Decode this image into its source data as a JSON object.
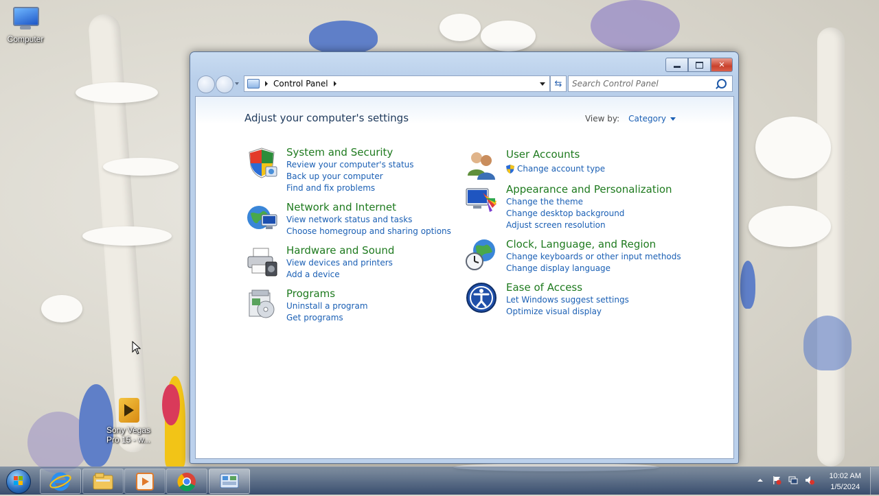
{
  "desktop": {
    "icons": [
      {
        "label": "Computer"
      },
      {
        "label": "Sony Vegas Pro 15 - w..."
      }
    ]
  },
  "window": {
    "breadcrumb": [
      "Control Panel"
    ],
    "search": {
      "placeholder": "Search Control Panel"
    },
    "page_title": "Adjust your computer's settings",
    "view_by": {
      "label": "View by:",
      "value": "Category"
    },
    "categories": [
      {
        "title": "System and Security",
        "icon": "shield-icon",
        "links": [
          "Review your computer's status",
          "Back up your computer",
          "Find and fix problems"
        ]
      },
      {
        "title": "Network and Internet",
        "icon": "network-icon",
        "links": [
          "View network status and tasks",
          "Choose homegroup and sharing options"
        ]
      },
      {
        "title": "Hardware and Sound",
        "icon": "printer-icon",
        "links": [
          "View devices and printers",
          "Add a device"
        ]
      },
      {
        "title": "Programs",
        "icon": "programs-icon",
        "links": [
          "Uninstall a program",
          "Get programs"
        ]
      },
      {
        "title": "User Accounts",
        "icon": "users-icon",
        "links": [
          "Change account type"
        ]
      },
      {
        "title": "Appearance and Personalization",
        "icon": "appearance-icon",
        "links": [
          "Change the theme",
          "Change desktop background",
          "Adjust screen resolution"
        ]
      },
      {
        "title": "Clock, Language, and Region",
        "icon": "clock-globe-icon",
        "links": [
          "Change keyboards or other input methods",
          "Change display language"
        ]
      },
      {
        "title": "Ease of Access",
        "icon": "ease-of-access-icon",
        "links": [
          "Let Windows suggest settings",
          "Optimize visual display"
        ]
      }
    ]
  },
  "taskbar": {
    "pinned": [
      "internet-explorer-icon",
      "file-explorer-icon",
      "media-player-icon",
      "chrome-icon",
      "control-panel-icon"
    ],
    "clock": {
      "time": "10:02 AM",
      "date": "1/5/2024"
    }
  },
  "colors": {
    "link": "#1a5fb4",
    "category_title": "#1e7a1e",
    "page_title": "#1e395b"
  }
}
